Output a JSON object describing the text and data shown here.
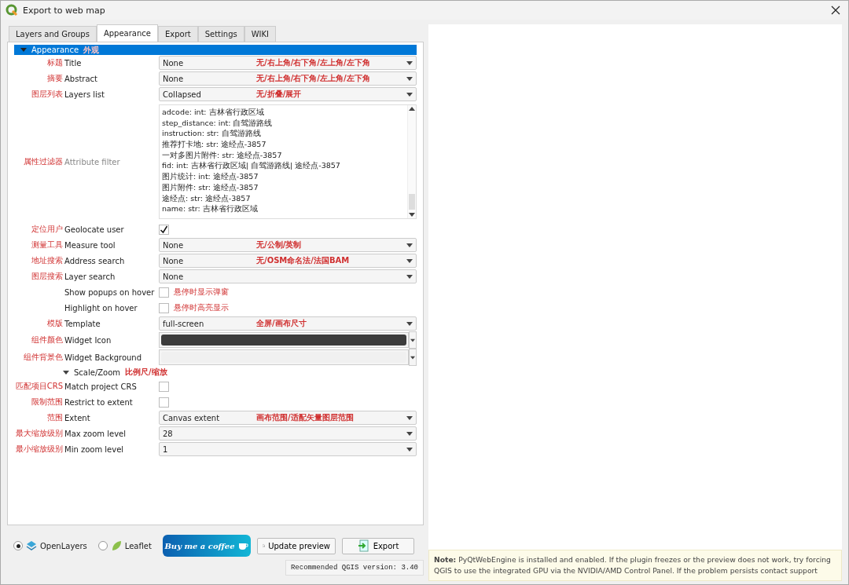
{
  "window": {
    "title": "Export to web map"
  },
  "tabs": [
    {
      "label": "Layers and Groups",
      "selected": false
    },
    {
      "label": "Appearance",
      "selected": true
    },
    {
      "label": "Export",
      "selected": false
    },
    {
      "label": "Settings",
      "selected": false
    },
    {
      "label": "WIKI",
      "selected": false
    }
  ],
  "rows": [
    {
      "kind": "section",
      "label": "Appearance",
      "annotation": "外观",
      "selected": true,
      "expanded": true
    },
    {
      "kind": "combo",
      "annotation": "标题",
      "label": "Title",
      "value": "None",
      "hint": "无/右上角/右下角/左上角/左下角"
    },
    {
      "kind": "combo",
      "annotation": "摘要",
      "label": "Abstract",
      "value": "None",
      "hint": "无/右上角/右下角/左上角/左下角"
    },
    {
      "kind": "combo",
      "annotation": "图层列表",
      "label": "Layers list",
      "value": "Collapsed",
      "hint": "无/折叠/展开"
    },
    {
      "kind": "list",
      "annotation": "属性过滤器",
      "label": "Attribute filter",
      "disabled": true,
      "items": [
        "adcode: int: 吉林省行政区域",
        "step_distance: int: 自驾游路线",
        "instruction: str: 自驾游路线",
        "推荐打卡地: str: 途经点-3857",
        "一对多图片附件: str: 途经点-3857",
        "fid: int: 吉林省行政区域| 自驾游路线| 途经点-3857",
        "图片统计: int: 途经点-3857",
        "图片附件: str: 途经点-3857",
        "途经点: str: 途经点-3857",
        "name: str: 吉林省行政区域"
      ]
    },
    {
      "kind": "checkbox",
      "annotation": "定位用户",
      "label": "Geolocate user",
      "checked": true
    },
    {
      "kind": "combo",
      "annotation": "测量工具",
      "label": "Measure tool",
      "value": "None",
      "hint": "无/公制/英制"
    },
    {
      "kind": "combo",
      "annotation": "地址搜索",
      "label": "Address search",
      "value": "None",
      "hint": "无/OSM命名法/法国BAM"
    },
    {
      "kind": "combo",
      "annotation": "图层搜索",
      "label": "Layer search",
      "value": "None"
    },
    {
      "kind": "checkbox",
      "label": "Show popups on hover",
      "checked": false,
      "hint": "悬停时显示弹窗"
    },
    {
      "kind": "checkbox",
      "label": "Highlight on hover",
      "checked": false,
      "hint": "悬停时高亮显示"
    },
    {
      "kind": "combo",
      "annotation": "模版",
      "label": "Template",
      "value": "full-screen",
      "hint": "全屏/画布尺寸"
    },
    {
      "kind": "color",
      "annotation": "组件颜色",
      "label": "Widget Icon",
      "color": "#3c3c3c"
    },
    {
      "kind": "color",
      "annotation": "组件背景色",
      "label": "Widget Background",
      "color": "#f0f0f0"
    },
    {
      "kind": "section",
      "label": "Scale/Zoom",
      "annotation": "比例尺/缩放",
      "selected": false,
      "expanded": true
    },
    {
      "kind": "checkbox",
      "annotation": "匹配项目CRS",
      "label": "Match project CRS",
      "checked": false
    },
    {
      "kind": "checkbox",
      "annotation": "限制范围",
      "label": "Restrict to extent",
      "checked": false
    },
    {
      "kind": "combo",
      "annotation": "范围",
      "label": "Extent",
      "value": "Canvas extent",
      "hint": "画布范围/适配矢量图层范围"
    },
    {
      "kind": "combo",
      "annotation": "最大缩放级别",
      "label": "Max zoom level",
      "value": "28"
    },
    {
      "kind": "combo",
      "annotation": "最小缩放级别",
      "label": "Min zoom level",
      "value": "1"
    }
  ],
  "libraries": [
    {
      "label": "OpenLayers",
      "selected": true
    },
    {
      "label": "Leaflet",
      "selected": false
    }
  ],
  "buttons": {
    "coffee": "Buy me a coffee",
    "update": "Update preview",
    "export": "Export"
  },
  "version": "Recommended QGIS version: 3.40",
  "note": {
    "label": "Note:",
    "text": "PyQtWebEngine is installed and enabled. If the plugin freezes or the preview does not work, try forcing QGIS to use the integrated GPU via the NVIDIA/AMD Control Panel. If the problem persists contact support"
  }
}
